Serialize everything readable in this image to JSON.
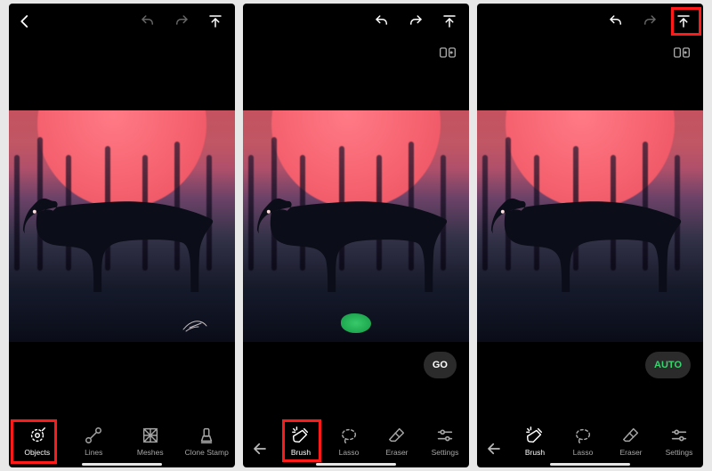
{
  "screens": [
    {
      "topbar": {
        "undo_dim": true,
        "redo_dim": true,
        "show_tagrow": false,
        "export_highlight": false
      },
      "canvas": {
        "show_scribble": true,
        "show_green_blob": false
      },
      "chip": null,
      "toolbar_mode": "main",
      "toolbar_labels": {
        "objects": "Objects",
        "lines": "Lines",
        "meshes": "Meshes",
        "clone": "Clone Stamp"
      },
      "highlight": "objects"
    },
    {
      "topbar": {
        "undo_dim": false,
        "redo_dim": false,
        "show_tagrow": true,
        "export_highlight": false
      },
      "canvas": {
        "show_scribble": false,
        "show_green_blob": true
      },
      "chip": {
        "label": "GO",
        "variant": "go"
      },
      "toolbar_mode": "brush_set",
      "toolbar_labels": {
        "brush": "Brush",
        "lasso": "Lasso",
        "eraser": "Eraser",
        "settings": "Settings"
      },
      "highlight": "brush"
    },
    {
      "topbar": {
        "undo_dim": false,
        "redo_dim": true,
        "show_tagrow": true,
        "export_highlight": true
      },
      "canvas": {
        "show_scribble": false,
        "show_green_blob": false
      },
      "chip": {
        "label": "AUTO",
        "variant": "auto"
      },
      "toolbar_mode": "brush_set",
      "toolbar_labels": {
        "brush": "Brush",
        "lasso": "Lasso",
        "eraser": "Eraser",
        "settings": "Settings"
      },
      "highlight": "export"
    }
  ]
}
